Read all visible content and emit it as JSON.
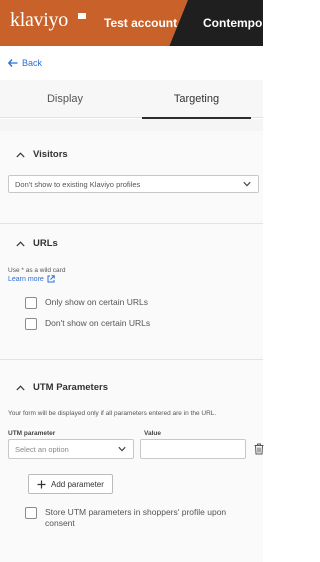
{
  "header": {
    "logo": "klaviyo",
    "account": "Test account",
    "breadcrumb": "Contempo"
  },
  "nav": {
    "back_label": "Back"
  },
  "tabs": [
    {
      "label": "Display",
      "active": false
    },
    {
      "label": "Targeting",
      "active": true
    }
  ],
  "visitors": {
    "title": "Visitors",
    "select_value": "Don't show to existing Klaviyo profiles"
  },
  "urls": {
    "title": "URLs",
    "hint": "Use * as a wild card",
    "learn_more": "Learn more",
    "options": [
      {
        "label": "Only show on certain URLs",
        "checked": false
      },
      {
        "label": "Don't show on certain URLs",
        "checked": false
      }
    ]
  },
  "utm": {
    "title": "UTM Parameters",
    "description": "Your form will be displayed only if all parameters entered are in the URL.",
    "col_param": "UTM parameter",
    "col_value": "Value",
    "param_placeholder": "Select an option",
    "value": "",
    "add_button": "Add parameter",
    "store_label": "Store UTM parameters in shoppers' profile upon consent",
    "store_checked": false
  },
  "colors": {
    "brand": "#c9622a",
    "breadcrumb_bg": "#1f1f1f",
    "link": "#2b6ed6"
  },
  "icons": [
    "back-arrow-icon",
    "chevron-up-icon",
    "chevron-down-icon",
    "external-link-icon",
    "trash-icon",
    "plus-icon"
  ]
}
